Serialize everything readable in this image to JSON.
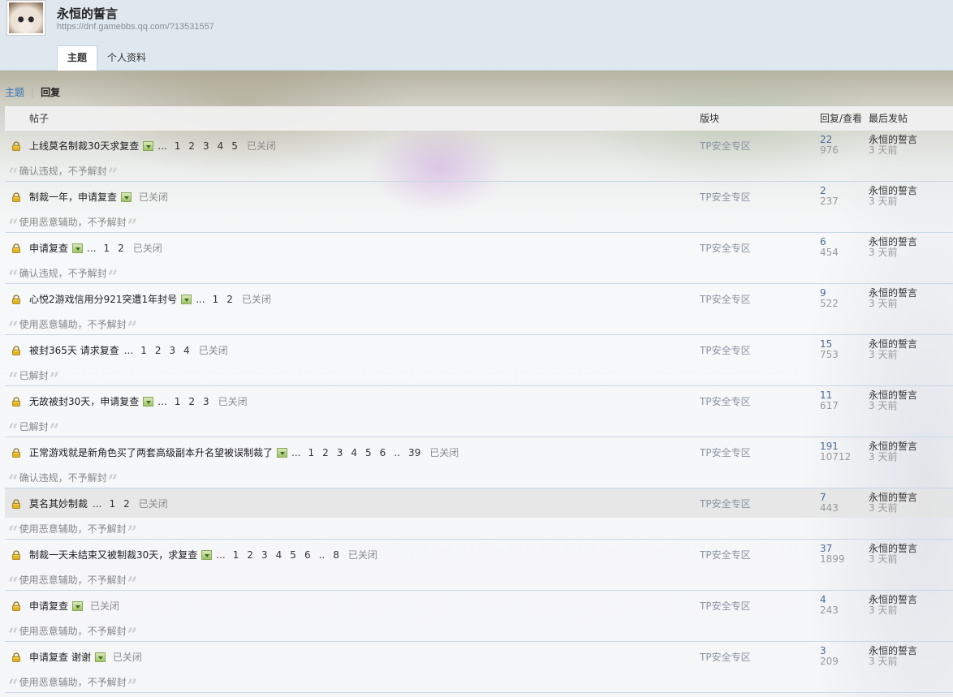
{
  "user": {
    "name": "永恒的誓言",
    "url": "https://dnf.gamebbs.qq.com/?13531557"
  },
  "tabs": [
    {
      "label": "主题",
      "active": true
    },
    {
      "label": "个人资料",
      "active": false
    }
  ],
  "subnav": {
    "topic_label": "主题",
    "separator": "|",
    "reply_label": "回复"
  },
  "table_header": {
    "post": "帖子",
    "forum": "版块",
    "reply_view": "回复/查看",
    "last_post": "最后发帖"
  },
  "common": {
    "ellipsis": "...",
    "closed": "已关闭",
    "quote_open": "“",
    "quote_close": "”"
  },
  "rows": [
    {
      "title": "上线莫名制裁30天求复查",
      "has_image": true,
      "pages": [
        "1",
        "2",
        "3",
        "4",
        "5"
      ],
      "forum": "TP安全专区",
      "replies": "22",
      "views": "976",
      "last_user": "永恒的誓言",
      "last_time": "3 天前",
      "reason": "确认违规，不予解封",
      "highlight": false
    },
    {
      "title": "制裁一年，申请复查",
      "has_image": true,
      "pages": [],
      "forum": "TP安全专区",
      "replies": "2",
      "views": "237",
      "last_user": "永恒的誓言",
      "last_time": "3 天前",
      "reason": "使用恶意辅助，不予解封",
      "highlight": false
    },
    {
      "title": "申请复查",
      "has_image": true,
      "pages": [
        "1",
        "2"
      ],
      "forum": "TP安全专区",
      "replies": "6",
      "views": "454",
      "last_user": "永恒的誓言",
      "last_time": "3 天前",
      "reason": "确认违规，不予解封",
      "highlight": false
    },
    {
      "title": "心悦2游戏信用分921突遭1年封号",
      "has_image": true,
      "pages": [
        "1",
        "2"
      ],
      "forum": "TP安全专区",
      "replies": "9",
      "views": "522",
      "last_user": "永恒的誓言",
      "last_time": "3 天前",
      "reason": "使用恶意辅助，不予解封",
      "highlight": false
    },
    {
      "title": "被封365天 请求复查",
      "has_image": false,
      "pages": [
        "1",
        "2",
        "3",
        "4"
      ],
      "forum": "TP安全专区",
      "replies": "15",
      "views": "753",
      "last_user": "永恒的誓言",
      "last_time": "3 天前",
      "reason": "已解封",
      "highlight": false
    },
    {
      "title": "无故被封30天，申请复查",
      "has_image": true,
      "pages": [
        "1",
        "2",
        "3"
      ],
      "forum": "TP安全专区",
      "replies": "11",
      "views": "617",
      "last_user": "永恒的誓言",
      "last_time": "3 天前",
      "reason": "已解封",
      "highlight": false
    },
    {
      "title": "正常游戏就是新角色买了两套高级副本升名望被误制裁了",
      "has_image": true,
      "pages": [
        "1",
        "2",
        "3",
        "4",
        "5",
        "6",
        "..",
        "39"
      ],
      "forum": "TP安全专区",
      "replies": "191",
      "views": "10712",
      "last_user": "永恒的誓言",
      "last_time": "3 天前",
      "reason": "确认违规，不予解封",
      "highlight": false
    },
    {
      "title": "莫名其妙制裁",
      "has_image": false,
      "pages": [
        "1",
        "2"
      ],
      "forum": "TP安全专区",
      "replies": "7",
      "views": "443",
      "last_user": "永恒的誓言",
      "last_time": "3 天前",
      "reason": "使用恶意辅助，不予解封",
      "highlight": true
    },
    {
      "title": "制裁一天未结束又被制裁30天，求复查",
      "has_image": true,
      "pages": [
        "1",
        "2",
        "3",
        "4",
        "5",
        "6",
        "..",
        "8"
      ],
      "forum": "TP安全专区",
      "replies": "37",
      "views": "1899",
      "last_user": "永恒的誓言",
      "last_time": "3 天前",
      "reason": "使用恶意辅助，不予解封",
      "highlight": false
    },
    {
      "title": "申请复查",
      "has_image": true,
      "pages": [],
      "forum": "TP安全专区",
      "replies": "4",
      "views": "243",
      "last_user": "永恒的誓言",
      "last_time": "3 天前",
      "reason": "使用恶意辅助，不予解封",
      "highlight": false
    },
    {
      "title": "申请复查 谢谢",
      "has_image": true,
      "pages": [],
      "forum": "TP安全专区",
      "replies": "3",
      "views": "209",
      "last_user": "永恒的誓言",
      "last_time": "3 天前",
      "reason": "使用恶意辅助，不予解封",
      "highlight": false
    }
  ],
  "icons": {
    "lock": "lock-icon",
    "image": "image-attachment-icon"
  },
  "colors": {
    "header_bg": "#dfe7ef",
    "link_blue": "#2f6fb3",
    "row_border": "#c8d7e6",
    "lock_gold": "#e2b21f"
  }
}
